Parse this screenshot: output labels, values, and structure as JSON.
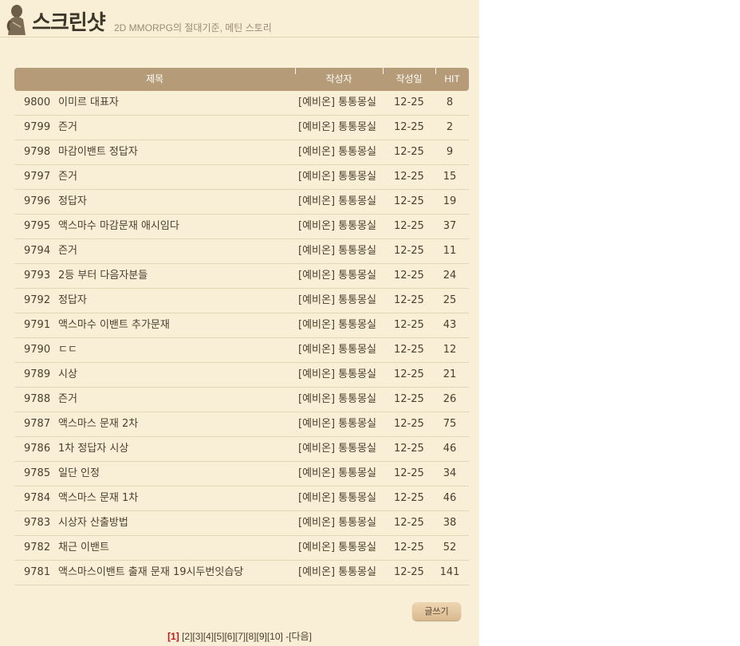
{
  "header": {
    "title": "스크린샷",
    "subtitle": "2D MMORPG의 절대기준, 메틴 스토리"
  },
  "table": {
    "columns": {
      "title": "제목",
      "author": "작성자",
      "date": "작성일",
      "hit": "HIT"
    },
    "rows": [
      {
        "no": "9800",
        "title": "이미르 대표자",
        "author": "[예비온] 통통몽실",
        "date": "12-25",
        "hit": "8"
      },
      {
        "no": "9799",
        "title": "즌거",
        "author": "[예비온] 통통몽실",
        "date": "12-25",
        "hit": "2"
      },
      {
        "no": "9798",
        "title": "마감이밴트 정답자",
        "author": "[예비온] 통통몽실",
        "date": "12-25",
        "hit": "9"
      },
      {
        "no": "9797",
        "title": "즌거",
        "author": "[예비온] 통통몽실",
        "date": "12-25",
        "hit": "15"
      },
      {
        "no": "9796",
        "title": "정답자",
        "author": "[예비온] 통통몽실",
        "date": "12-25",
        "hit": "19"
      },
      {
        "no": "9795",
        "title": "액스마수 마감문재 애시임다",
        "author": "[예비온] 통통몽실",
        "date": "12-25",
        "hit": "37"
      },
      {
        "no": "9794",
        "title": "즌거",
        "author": "[예비온] 통통몽실",
        "date": "12-25",
        "hit": "11"
      },
      {
        "no": "9793",
        "title": "2등 부터 다음자분들",
        "author": "[예비온] 통통몽실",
        "date": "12-25",
        "hit": "24"
      },
      {
        "no": "9792",
        "title": "정답자",
        "author": "[예비온] 통통몽실",
        "date": "12-25",
        "hit": "25"
      },
      {
        "no": "9791",
        "title": "액스마수 이밴트 추가문재",
        "author": "[예비온] 통통몽실",
        "date": "12-25",
        "hit": "43"
      },
      {
        "no": "9790",
        "title": "ㄷㄷ",
        "author": "[예비온] 통통몽실",
        "date": "12-25",
        "hit": "12"
      },
      {
        "no": "9789",
        "title": "시상",
        "author": "[예비온] 통통몽실",
        "date": "12-25",
        "hit": "21"
      },
      {
        "no": "9788",
        "title": "즌거",
        "author": "[예비온] 통통몽실",
        "date": "12-25",
        "hit": "26"
      },
      {
        "no": "9787",
        "title": "액스마스 문재 2차",
        "author": "[예비온] 통통몽실",
        "date": "12-25",
        "hit": "75"
      },
      {
        "no": "9786",
        "title": "1차 정답자 시상",
        "author": "[예비온] 통통몽실",
        "date": "12-25",
        "hit": "46"
      },
      {
        "no": "9785",
        "title": "일단 인정",
        "author": "[예비온] 통통몽실",
        "date": "12-25",
        "hit": "34"
      },
      {
        "no": "9784",
        "title": "액스마스 문재 1차",
        "author": "[예비온] 통통몽실",
        "date": "12-25",
        "hit": "46"
      },
      {
        "no": "9783",
        "title": "시상자 산출방법",
        "author": "[예비온] 통통몽실",
        "date": "12-25",
        "hit": "38"
      },
      {
        "no": "9782",
        "title": "채근 이밴트",
        "author": "[예비온] 통통몽실",
        "date": "12-25",
        "hit": "52"
      },
      {
        "no": "9781",
        "title": "액스마스이밴트 출재 문재 19시두번잇습당",
        "author": "[예비온] 통통몽실",
        "date": "12-25",
        "hit": "141"
      }
    ]
  },
  "actions": {
    "write_label": "글쓰기"
  },
  "pagination": {
    "current": "[1]",
    "pages": [
      "[2]",
      "[3]",
      "[4]",
      "[5]",
      "[6]",
      "[7]",
      "[8]",
      "[9]",
      "[10]"
    ],
    "next": "-[다음]"
  },
  "colors": {
    "panel_bg": "#f8efd6",
    "header_bar": "#b69b78",
    "current_page": "#c0151b"
  },
  "icons": {
    "logo": "figure-logo-icon"
  }
}
